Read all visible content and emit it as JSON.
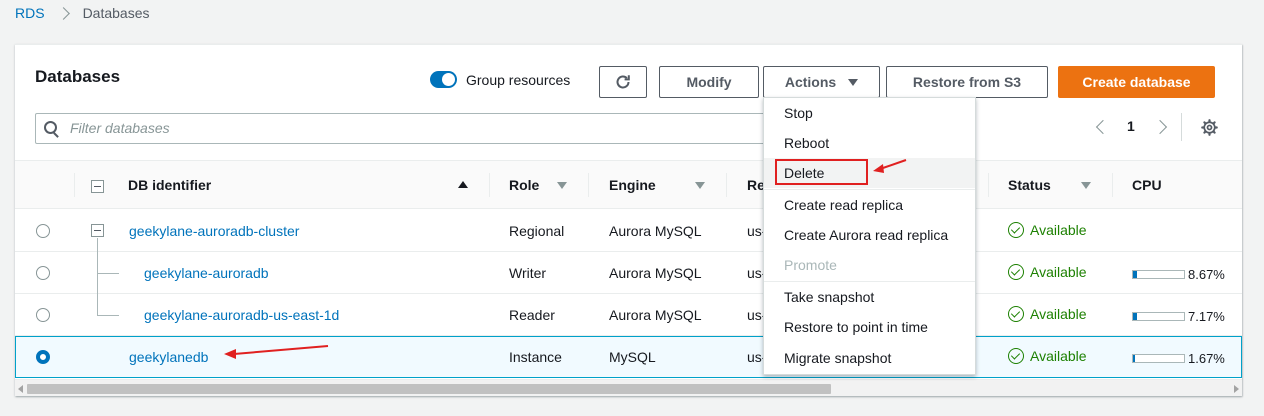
{
  "breadcrumb": {
    "root": "RDS",
    "current": "Databases"
  },
  "panel": {
    "title": "Databases"
  },
  "toolbar": {
    "group_label": "Group resources",
    "group_enabled": true,
    "refresh_icon": "refresh-icon",
    "modify_label": "Modify",
    "actions_label": "Actions",
    "restore_label": "Restore from S3",
    "create_label": "Create database",
    "create_color": "#ec7211"
  },
  "filter": {
    "placeholder": "Filter databases",
    "value": ""
  },
  "pagination": {
    "current_page": "1"
  },
  "table": {
    "columns": {
      "identifier": "DB identifier",
      "role": "Role",
      "engine": "Engine",
      "region": "Re",
      "status": "Status",
      "cpu": "CPU"
    },
    "rows": [
      {
        "identifier": "geekylane-auroradb-cluster",
        "role": "Regional",
        "engine": "Aurora MySQL",
        "region": "us-",
        "status": "Available",
        "cpu": null,
        "selected": false
      },
      {
        "identifier": "geekylane-auroradb",
        "role": "Writer",
        "engine": "Aurora MySQL",
        "region": "us-",
        "status": "Available",
        "cpu": "8.67%",
        "cpu_value": 8.67,
        "selected": false
      },
      {
        "identifier": "geekylane-auroradb-us-east-1d",
        "role": "Reader",
        "engine": "Aurora MySQL",
        "region": "us-",
        "status": "Available",
        "cpu": "7.17%",
        "cpu_value": 7.17,
        "selected": false
      },
      {
        "identifier": "geekylanedb",
        "role": "Instance",
        "engine": "MySQL",
        "region": "us-",
        "status": "Available",
        "cpu": "1.67%",
        "cpu_value": 1.67,
        "selected": true
      }
    ]
  },
  "actions_menu": {
    "items": [
      {
        "label": "Stop",
        "disabled": false
      },
      {
        "label": "Reboot",
        "disabled": false
      },
      {
        "label": "Delete",
        "disabled": false
      },
      {
        "label": "Create read replica",
        "disabled": false
      },
      {
        "label": "Create Aurora read replica",
        "disabled": false
      },
      {
        "label": "Promote",
        "disabled": true
      },
      {
        "label": "Take snapshot",
        "disabled": false
      },
      {
        "label": "Restore to point in time",
        "disabled": false
      },
      {
        "label": "Migrate snapshot",
        "disabled": false
      }
    ]
  },
  "colors": {
    "link": "#0073bb",
    "available": "#1d8102",
    "annotation": "#e02020"
  }
}
